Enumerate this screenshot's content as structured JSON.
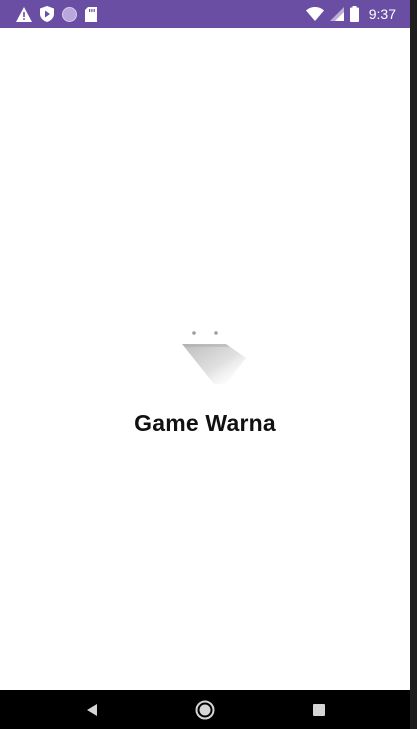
{
  "status_bar": {
    "time": "9:37",
    "left_icons": [
      "warning-icon",
      "shield-play-icon",
      "circle-icon",
      "sd-card-icon"
    ],
    "right_icons": [
      "wifi-icon",
      "cell-signal-icon",
      "battery-icon"
    ],
    "background_color": "#6a4ea3"
  },
  "splash": {
    "title": "Game Warna",
    "logo_icon": "tag-logo-icon"
  },
  "nav_bar": {
    "buttons": [
      "back-button",
      "home-button",
      "recents-button"
    ]
  }
}
